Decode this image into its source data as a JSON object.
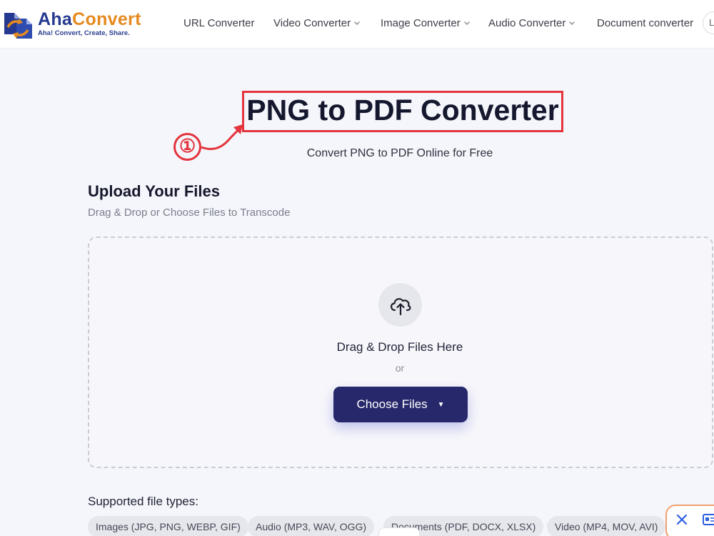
{
  "header": {
    "logo": {
      "name_part1": "Aha",
      "name_part2": "Convert",
      "tagline": "Aha! Convert, Create, Share."
    },
    "nav": [
      {
        "label": "URL Converter",
        "has_dropdown": false
      },
      {
        "label": "Video Converter",
        "has_dropdown": true
      },
      {
        "label": "Image Converter",
        "has_dropdown": true
      },
      {
        "label": "Audio Converter",
        "has_dropdown": true
      },
      {
        "label": "Document converter",
        "has_dropdown": false
      }
    ],
    "language_chip": "Lo"
  },
  "hero": {
    "title": "PNG to PDF Converter",
    "subtitle": "Convert PNG to PDF Online for Free",
    "step_marker": "①"
  },
  "upload": {
    "title": "Upload Your Files",
    "subtitle": "Drag & Drop or Choose Files to Transcode",
    "drop_text": "Drag & Drop Files Here",
    "or_text": "or",
    "button_label": "Choose Files",
    "button_caret": "▼"
  },
  "supported": {
    "label": "Supported file types:",
    "chips": [
      "Images (JPG, PNG, WEBP, GIF)",
      "Audio (MP3, WAV, OGG)",
      "Documents (PDF, DOCX, XLSX)",
      "Video (MP4, MOV, AVI)"
    ]
  },
  "colors": {
    "brand_blue": "#24398f",
    "brand_orange": "#e58a1f",
    "annotation_red": "#e4343d",
    "button_bg": "#27286b"
  },
  "icons": {
    "logo": "file-convert-logo-icon",
    "upload": "cloud-upload-icon",
    "dropdown": "chevron-down-icon",
    "close": "close-icon",
    "widget": "card-icon"
  }
}
